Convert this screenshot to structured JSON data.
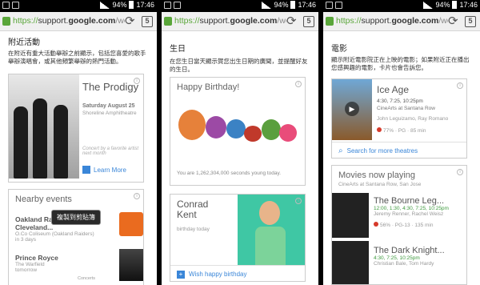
{
  "status_bar": {
    "time": "17:46",
    "battery": "94%"
  },
  "browser": {
    "url_scheme": "https://",
    "url_host": "support.",
    "url_domain": "google.com",
    "url_path": "/webse",
    "tab_count": "5"
  },
  "screen1": {
    "section_title": "附近活動",
    "section_desc": "在附近有重大活動舉辦之前顯示，包括您喜愛的歌手舉辦演唱會，或其他頻繁舉辦的熱門活動。",
    "concert_card": {
      "artist": "The Prodigy",
      "date": "Saturday August 25",
      "venue": "Shoreline Amphitheatre",
      "note": "Concert by a favorite artist next month",
      "learn_more": "Learn More"
    },
    "nearby_card": {
      "title": "Nearby events",
      "events": [
        {
          "name": "Oakland Raiders vs. Cleveland...",
          "venue": "O.Co Coliseum (Oakland Raiders)",
          "when": "in 3 days"
        },
        {
          "name": "Prince Royce",
          "venue": "The Warfield",
          "when": "tomorrow",
          "tag": "Concerts"
        }
      ]
    },
    "tooltip": "複製到剪貼簿"
  },
  "screen2": {
    "section_title": "生日",
    "section_desc": "在您生日當天顯示賀您出生日期的廣聞，並提醒好友的生日。",
    "birthday_card": {
      "title": "Happy Birthday!",
      "seconds_text": "You are 1,262,304,000 seconds young today."
    },
    "friend_card": {
      "name_line1": "Conrad",
      "name_line2": "Kent",
      "subtitle": "birthday today",
      "action": "Wish happy birthday"
    }
  },
  "screen3": {
    "section_title": "電影",
    "section_desc": "顯示附近電影院正在上映的電影；如果附近正在播出您感興趣的電影，卡片也會告訴您。",
    "movie_card": {
      "title": "Ice Age",
      "times": "4:30, 7:25, 10:25pm",
      "theater": "CineArts at Santana Row",
      "cast": "John Leguizamo, Ray Romano",
      "rating": "77% · PG · 85 min",
      "action": "Search for more theatres"
    },
    "now_playing": {
      "title": "Movies now playing",
      "subtitle": "CineArts at Santana Row, San Jose",
      "movies": [
        {
          "title": "The Bourne Leg...",
          "times": "12:00, 1:30, 4:30, 7:25, 10:25pm",
          "cast": "Jeremy Renner, Rachel Weisz",
          "rating": "56% · PG-13 · 135 min"
        },
        {
          "title": "The Dark Knight...",
          "times": "4:30, 7:25, 10:25pm",
          "cast": "Christian Bale, Tom Hardy"
        }
      ]
    }
  },
  "colors": {
    "link": "#3a86d8",
    "lock": "#5aa63a",
    "teal": "#3fc7a4",
    "orange": "#ea6b1f"
  },
  "icons": [
    "lock-icon",
    "reload-icon",
    "tabs-icon",
    "info-icon",
    "search-icon",
    "plus-icon",
    "cake-icon"
  ]
}
